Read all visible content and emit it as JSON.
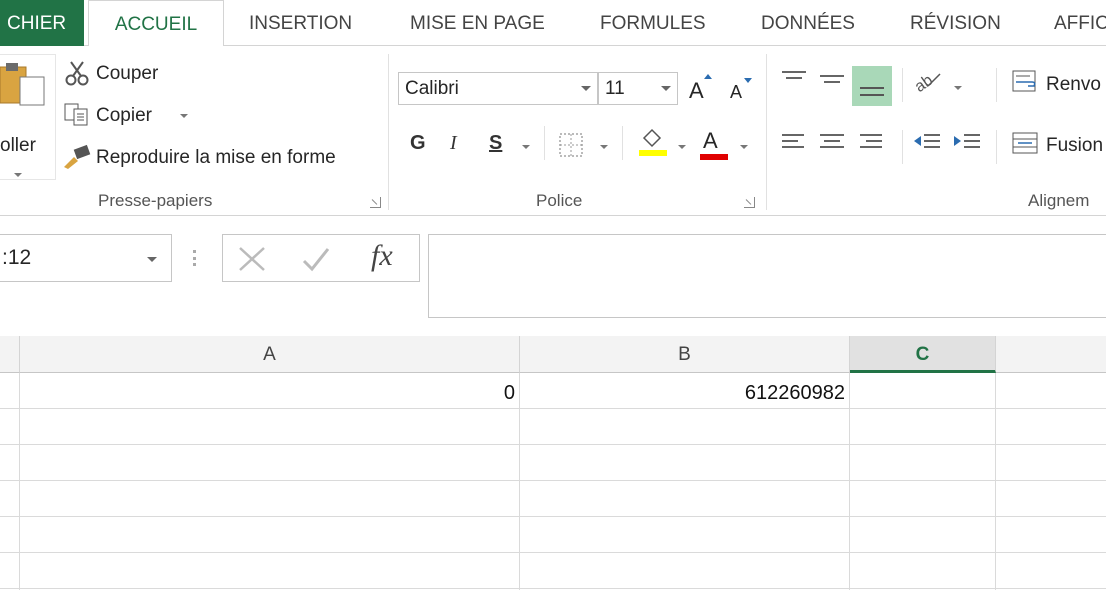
{
  "tabs": [
    "CHIER",
    "ACCUEIL",
    "INSERTION",
    "MISE EN PAGE",
    "FORMULES",
    "DONNÉES",
    "RÉVISION",
    "AFFIC"
  ],
  "clipboard": {
    "paste_label": "oller",
    "cut_label": "Couper",
    "copy_label": "Copier",
    "format_painter_label": "Reproduire la mise en forme",
    "group_label": "Presse-papiers"
  },
  "font": {
    "name": "Calibri",
    "size": "11",
    "grow_label": "A",
    "shrink_label": "A",
    "bold_label": "G",
    "italic_label": "I",
    "underline_label": "S",
    "font_color_label": "A",
    "group_label": "Police",
    "fill_color": "#ffff00",
    "text_color": "#e00000"
  },
  "alignment": {
    "wrap_label": "Renvo",
    "merge_label": "Fusion",
    "group_label": "Alignem"
  },
  "formula_bar": {
    "name_box": ":12",
    "fx_label": "fx",
    "value": ""
  },
  "grid": {
    "columns": [
      "A",
      "B",
      "C"
    ],
    "selected_column": "C",
    "rows": [
      [
        "0",
        "612260982",
        ""
      ]
    ]
  },
  "colors": {
    "accent": "#217346",
    "selected_align": "#a9d8b8"
  }
}
